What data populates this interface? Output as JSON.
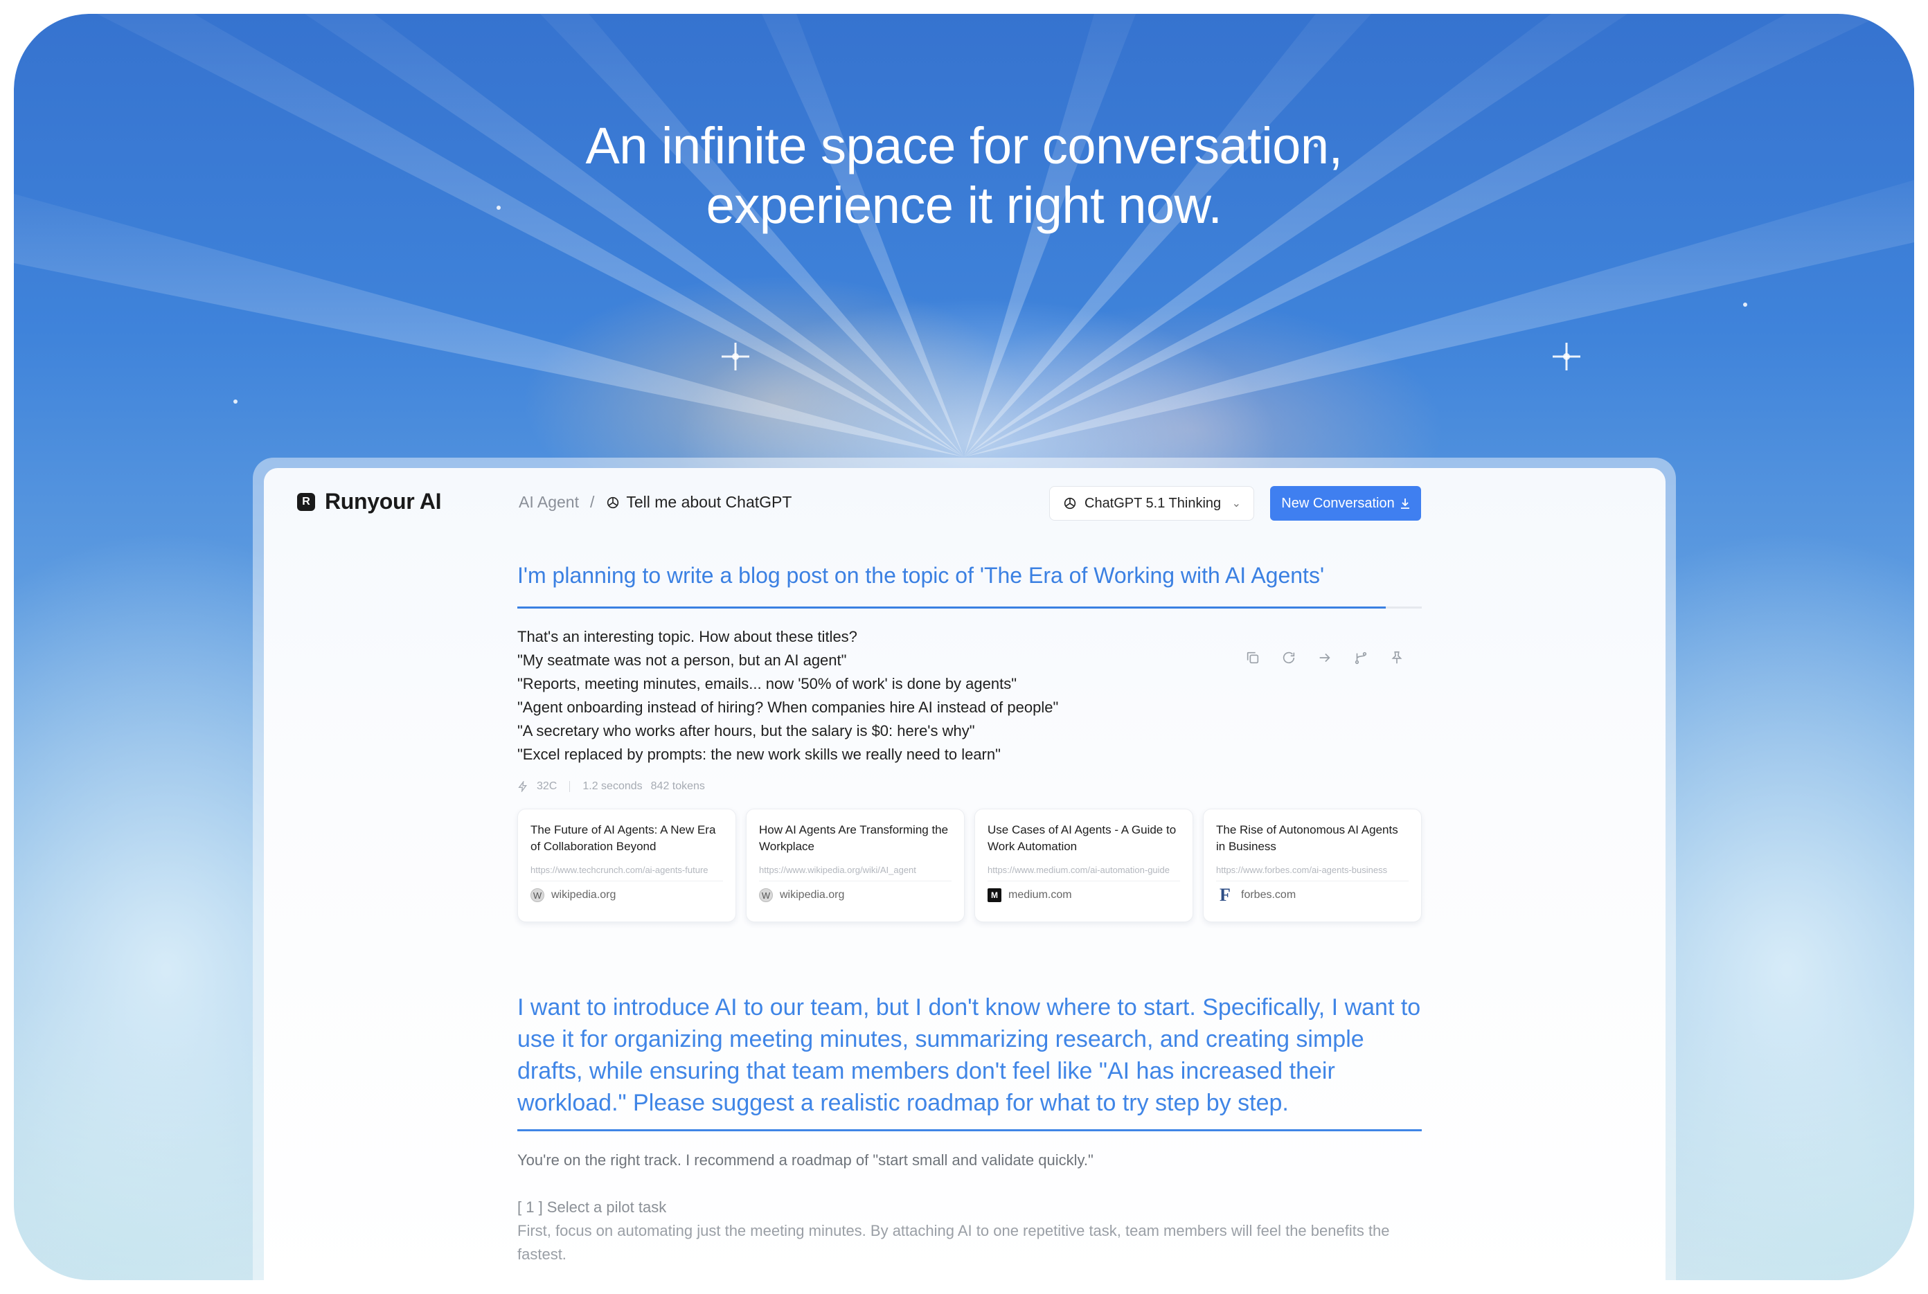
{
  "hero": {
    "title_line1": "An infinite space for conversation,",
    "title_line2": "experience it right now."
  },
  "app": {
    "logo_text": "Runyour AI",
    "logo_letter": "R",
    "breadcrumb": {
      "parent": "AI Agent",
      "separator": "/",
      "current": "Tell me about ChatGPT"
    },
    "model_select": {
      "value": "ChatGPT 5.1 Thinking",
      "icon": "openai-icon"
    },
    "new_conversation": {
      "label": "New Conversation",
      "icon": "download-icon"
    },
    "accent": "#3f7ff0"
  },
  "thread": {
    "q1": "I'm planning to write a blog post on the topic of 'The Era of Working with AI Agents'",
    "a1": [
      "That's an interesting topic. How about these titles?",
      "\"My seatmate was not a person, but an AI agent\"",
      "\"Reports, meeting minutes, emails... now '50% of work' is done by agents\"",
      "\"Agent onboarding instead of hiring? When companies hire AI instead of people\"",
      "\"A secretary who works after hours, but the salary is $0: here's why\"",
      "\"Excel replaced by prompts: the new work skills we really need to learn\""
    ],
    "actions": [
      "copy-icon",
      "regenerate-icon",
      "share-icon",
      "branch-icon",
      "pin-icon"
    ],
    "meta": {
      "credits": "32C",
      "time": "1.2 seconds",
      "tokens": "842 tokens"
    },
    "sources": [
      {
        "title": "The Future of AI Agents: A New Era of Collaboration Beyond",
        "url": "https://www.techcrunch.com/ai-agents-future",
        "site": "wikipedia.org",
        "icon": "wikipedia-icon"
      },
      {
        "title": "How AI Agents Are Transforming the Workplace",
        "url": "https://www.wikipedia.org/wiki/AI_agent",
        "site": "wikipedia.org",
        "icon": "wikipedia-icon"
      },
      {
        "title": "Use Cases of AI Agents - A Guide to Work Automation",
        "url": "https://www.medium.com/ai-automation-guide",
        "site": "medium.com",
        "icon": "medium-icon"
      },
      {
        "title": "The Rise of Autonomous AI Agents in Business",
        "url": "https://www.forbes.com/ai-agents-business",
        "site": "forbes.com",
        "icon": "forbes-icon"
      }
    ],
    "q2": "I want to introduce AI to our team, but I don't know where to start. Specifically, I want to use it for organizing meeting minutes, summarizing research, and creating simple drafts, while ensuring that team members don't feel like \"AI has increased their workload.\" Please suggest a realistic roadmap for what to try step by step.",
    "a2": {
      "intro": "You're on the right track. I recommend a roadmap of \"start small and validate quickly.\"",
      "step1_title": "[ 1 ] Select a pilot task",
      "step1_body": "First, focus on automating just the meeting minutes. By attaching AI to one repetitive task, team members will feel the benefits the fastest."
    }
  }
}
